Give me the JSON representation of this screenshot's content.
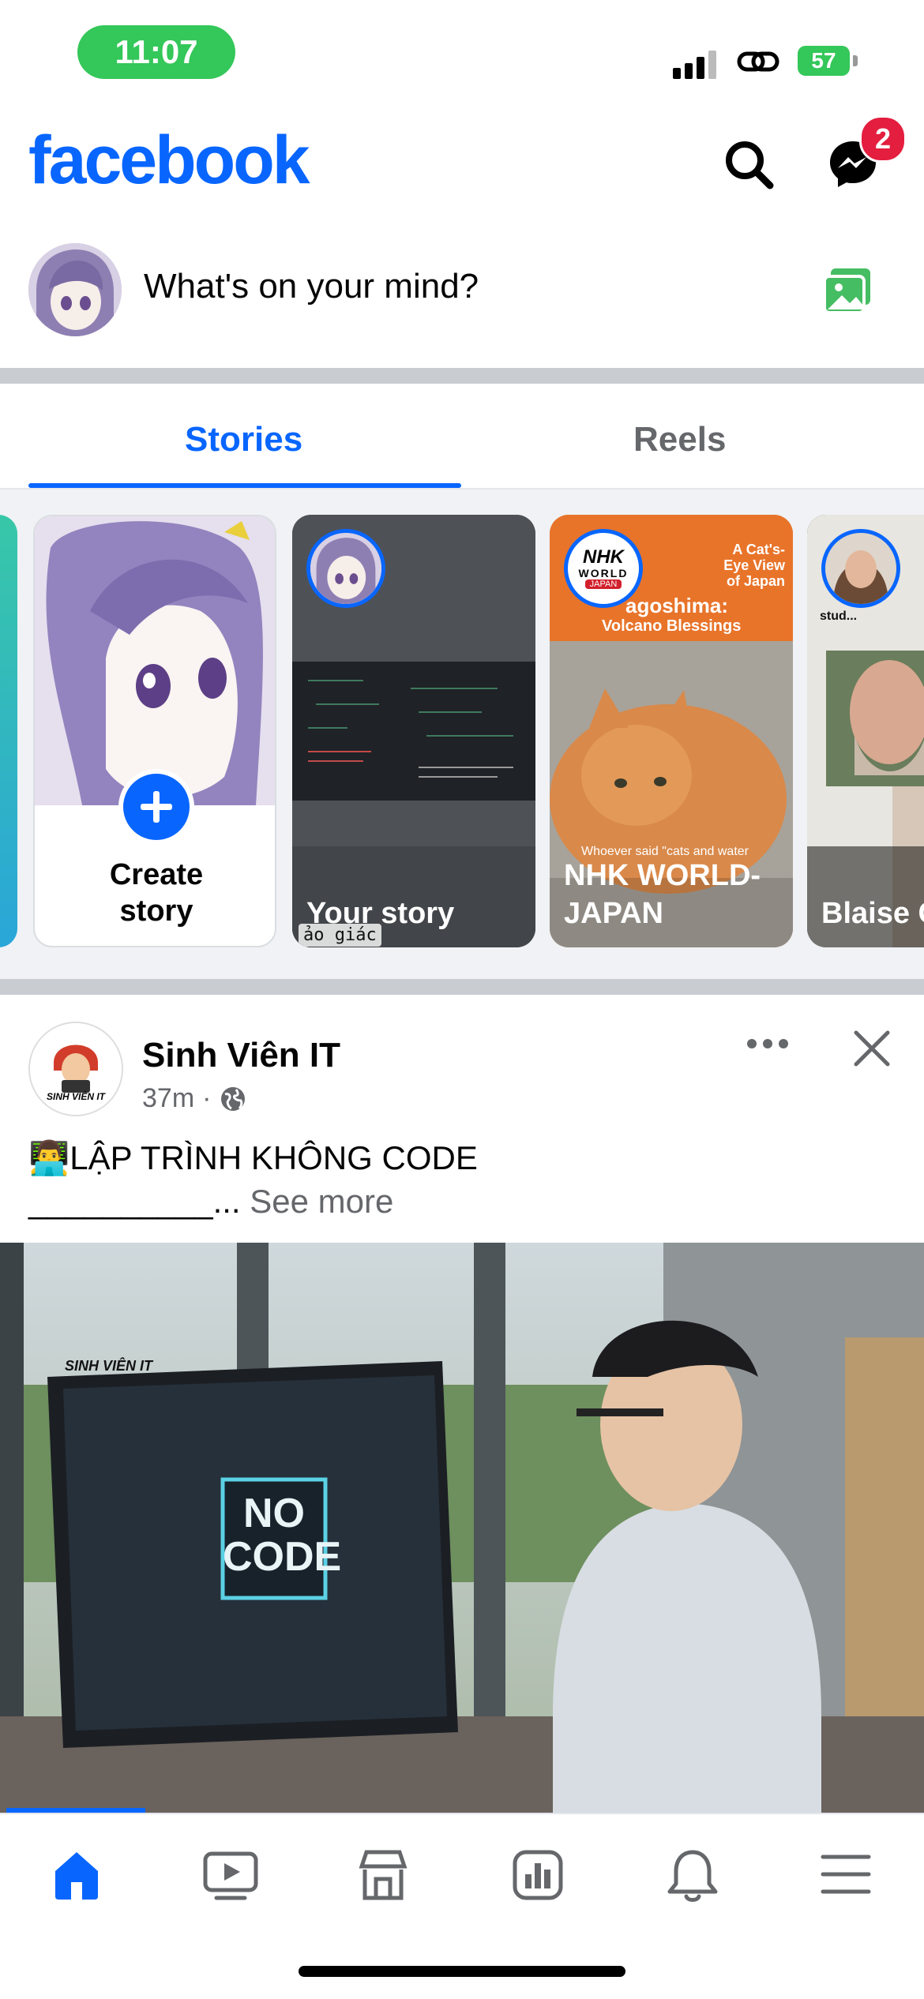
{
  "status_bar": {
    "time": "11:07",
    "battery": "57"
  },
  "header": {
    "logo": "facebook",
    "messenger_badge": "2",
    "icons": [
      "search-icon",
      "messenger-icon"
    ]
  },
  "composer": {
    "placeholder": "What's on your mind?",
    "icon": "photo-icon"
  },
  "tabs": [
    {
      "label": "Stories",
      "active": true
    },
    {
      "label": "Reels",
      "active": false
    }
  ],
  "stories": {
    "create": {
      "line1": "Create",
      "line2": "story"
    },
    "items": [
      {
        "name": "Your story",
        "caption": "ảo giác"
      },
      {
        "name_line1": "NHK WORLD-",
        "name_line2": "JAPAN",
        "logo_top": "NHK",
        "logo_mid": "WORLD",
        "logo_bot": "JAPAN",
        "banner_line1": "A Cat's-",
        "banner_line2": "Eye View",
        "banner_line3": "of Japan",
        "headline1": "agoshima:",
        "headline2": "Volcano Blessings",
        "subtitle": "Whoever said \"cats and water"
      },
      {
        "name": "Blaise C",
        "overlay_text": "stud..."
      }
    ]
  },
  "post": {
    "author": "Sinh Viên IT",
    "time": "37m",
    "emoji": "👨‍💻",
    "text": "LẬP TRÌNH KHÔNG CODE",
    "underline": "__________...",
    "see_more": "See more",
    "image_logo": "SINH VIÊN IT",
    "image_screen": {
      "line1": "NO",
      "line2": "CODE"
    },
    "avatar_caption": "SINH VIÊN IT"
  },
  "bottom_nav": [
    "home-icon",
    "video-icon",
    "marketplace-icon",
    "dashboard-icon",
    "notifications-icon",
    "menu-icon"
  ],
  "colors": {
    "brand": "#0866ff",
    "badge": "#e41e3f",
    "status_green": "#34c759",
    "divider": "#c9ccd1"
  }
}
